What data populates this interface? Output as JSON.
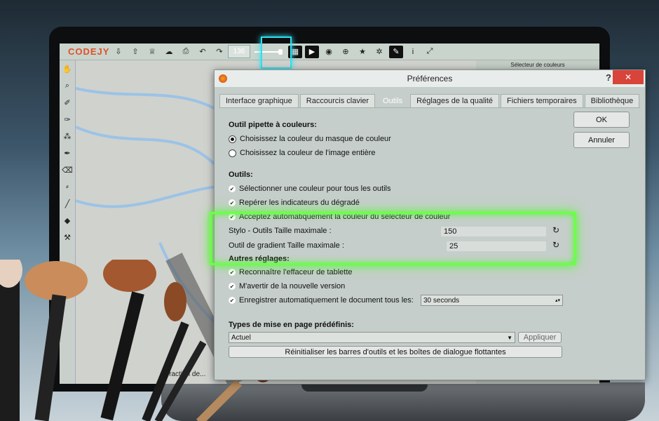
{
  "app": {
    "logo": "CODEJY",
    "brush_size": "136",
    "right_panel_title": "Sélecteur de couleurs",
    "canvas_caption": "Fraction de..."
  },
  "dialog": {
    "title": "Préférences",
    "help": "?",
    "close": "✕",
    "tabs": [
      "Interface graphique",
      "Raccourcis clavier",
      "Outils",
      "Réglages de la qualité",
      "Fichiers temporaires",
      "Bibliothèque"
    ],
    "active_tab": "Outils",
    "ok_label": "OK",
    "cancel_label": "Annuler",
    "section_picker": "Outil pipette à couleurs:",
    "picker_options": [
      "Choisissez la couleur du masque de couleur",
      "Choisissez la couleur de l'image entière"
    ],
    "section_tools": "Outils:",
    "tool_options": [
      "Sélectionner une couleur pour tous les outils",
      "Repérer les indicateurs du dégradé",
      "Acceptez automatiquement la couleur du sélecteur de couleur"
    ],
    "pen_label": "Stylo - Outils Taille maximale :",
    "pen_value": "150",
    "gradient_label": "Outil de gradient Taille maximale :",
    "gradient_value": "25",
    "section_other": "Autres réglages:",
    "other_options": [
      "Reconnaître l'effaceur de tablette",
      "M'avertir de la nouvelle version"
    ],
    "autosave_label": "Enregistrer automatiquement le document tous les:",
    "autosave_value": "30 seconds",
    "section_layout": "Types de mise en page prédéfinis:",
    "layout_value": "Actuel",
    "apply_label": "Appliquer",
    "reset_label": "Réinitialiser les barres d'outils et les boîtes de dialogue flottantes"
  },
  "colors": {
    "highlight_green": "#6cff4a",
    "highlight_cyan": "#30e0f0",
    "close_red": "#d8433a"
  }
}
